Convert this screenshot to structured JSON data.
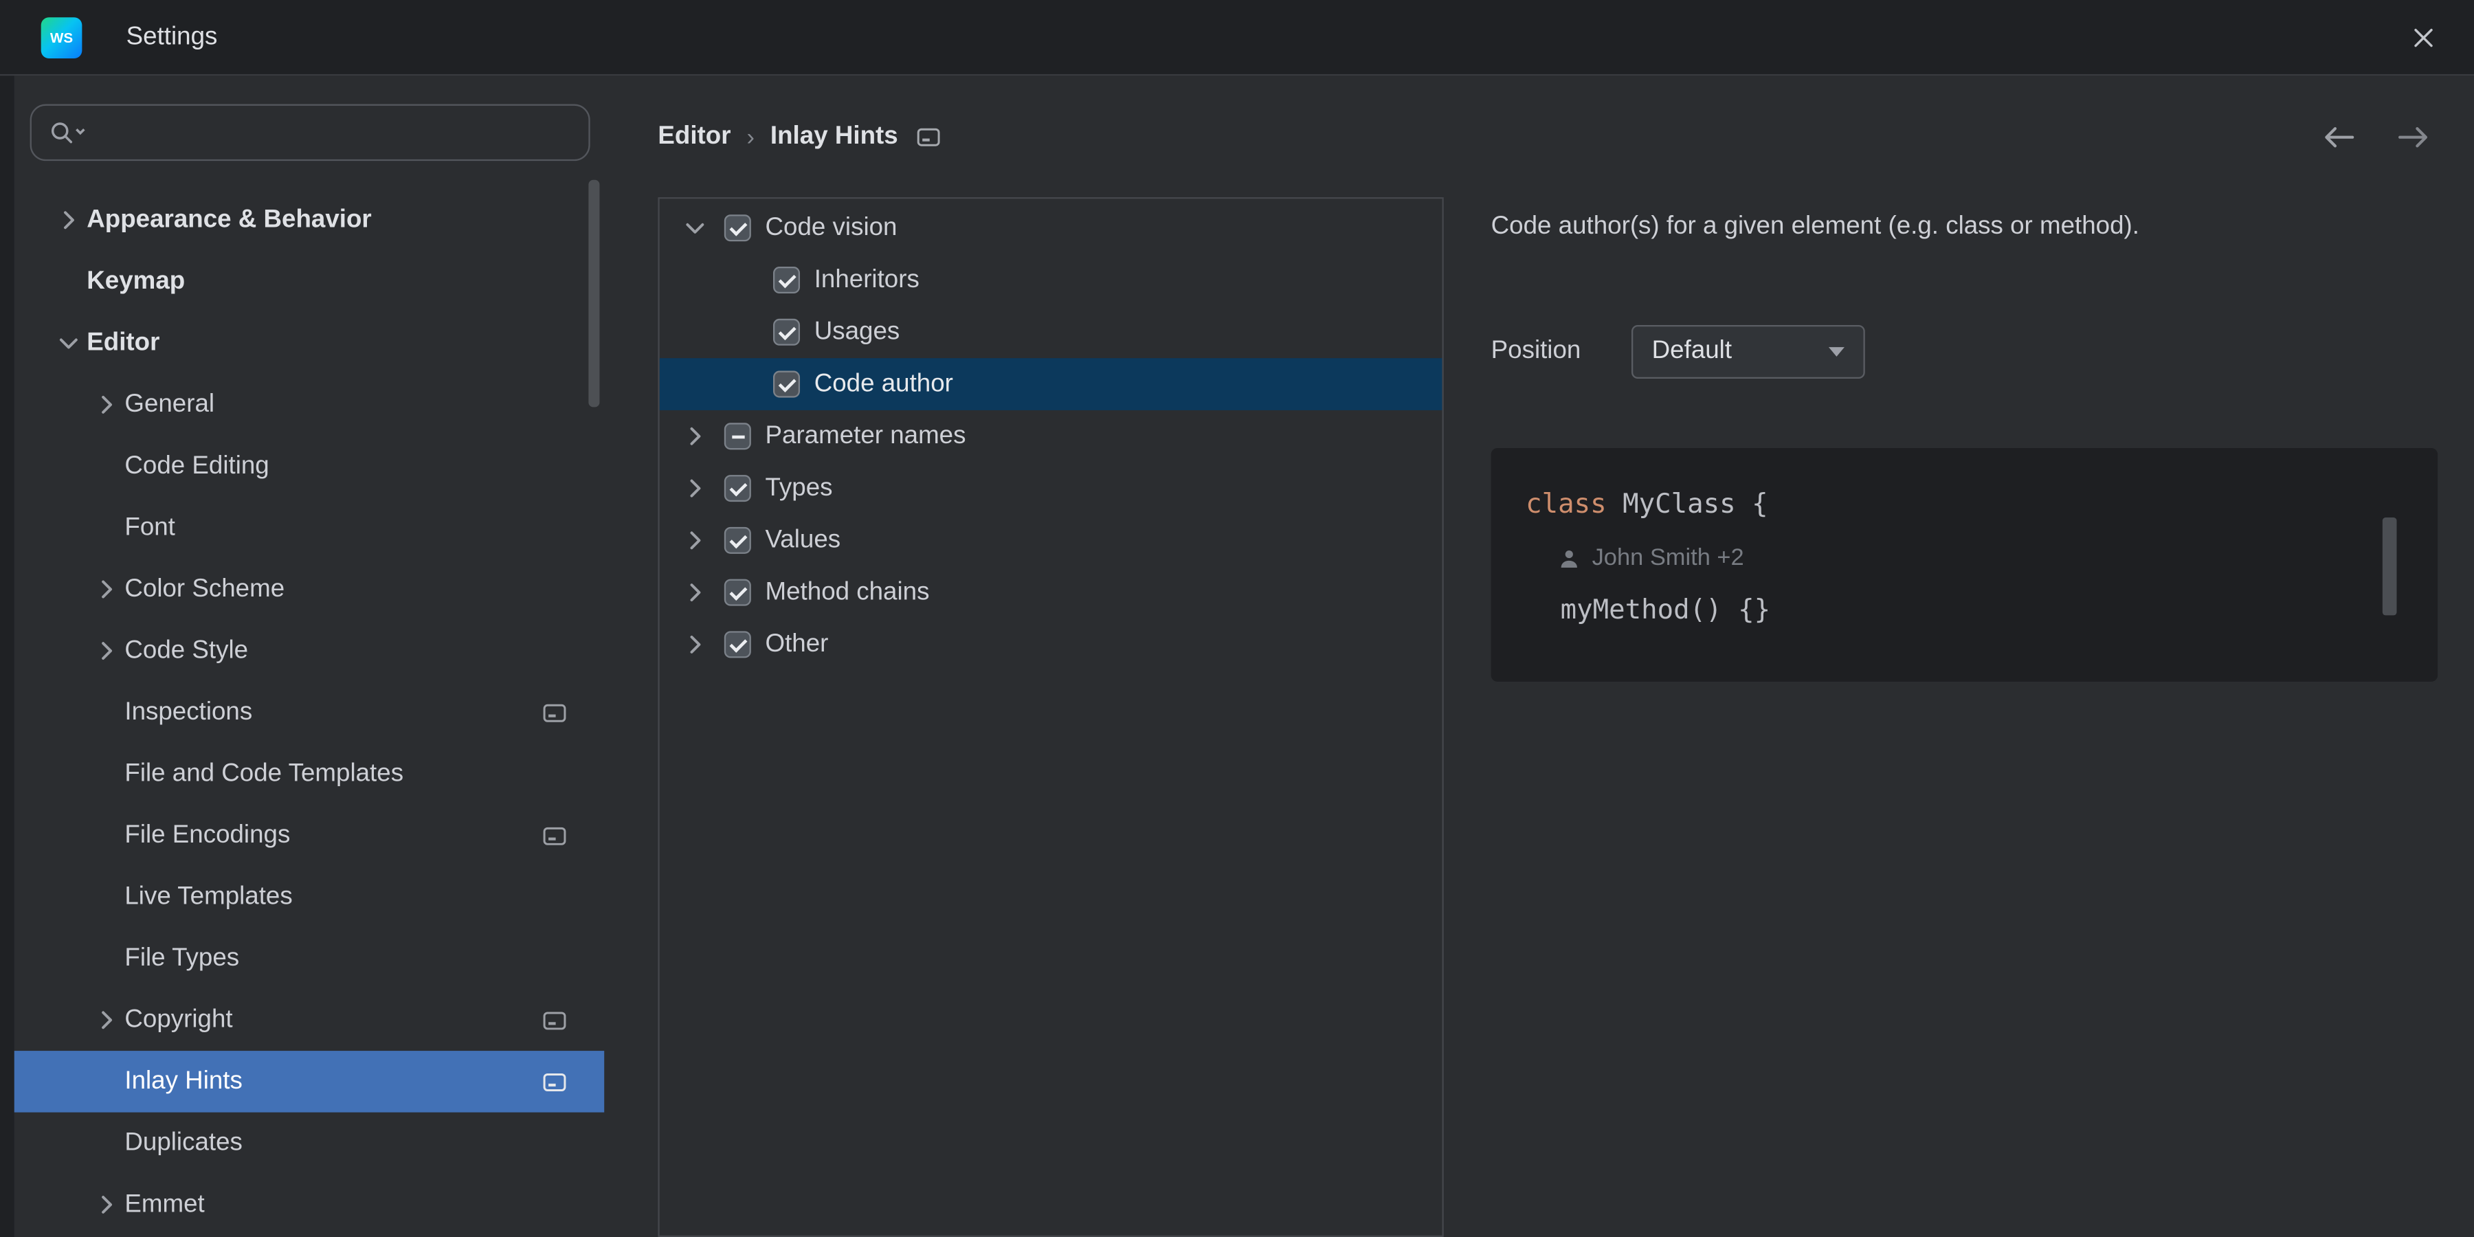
{
  "window": {
    "title": "Settings",
    "logo_text": "WS"
  },
  "sidebar": {
    "search_placeholder": "",
    "items": [
      {
        "label": "Appearance & Behavior",
        "indent": 0,
        "bold": true,
        "chevron": "right"
      },
      {
        "label": "Keymap",
        "indent": 0,
        "bold": true
      },
      {
        "label": "Editor",
        "indent": 0,
        "bold": true,
        "chevron": "down"
      },
      {
        "label": "General",
        "indent": 1,
        "chevron": "right"
      },
      {
        "label": "Code Editing",
        "indent": 1
      },
      {
        "label": "Font",
        "indent": 1
      },
      {
        "label": "Color Scheme",
        "indent": 1,
        "chevron": "right"
      },
      {
        "label": "Code Style",
        "indent": 1,
        "chevron": "right"
      },
      {
        "label": "Inspections",
        "indent": 1,
        "trailing_icon": true
      },
      {
        "label": "File and Code Templates",
        "indent": 1
      },
      {
        "label": "File Encodings",
        "indent": 1,
        "trailing_icon": true
      },
      {
        "label": "Live Templates",
        "indent": 1
      },
      {
        "label": "File Types",
        "indent": 1
      },
      {
        "label": "Copyright",
        "indent": 1,
        "chevron": "right",
        "trailing_icon": true
      },
      {
        "label": "Inlay Hints",
        "indent": 1,
        "trailing_icon": true,
        "selected": true
      },
      {
        "label": "Duplicates",
        "indent": 1
      },
      {
        "label": "Emmet",
        "indent": 1,
        "chevron": "right"
      }
    ]
  },
  "breadcrumb": {
    "parent": "Editor",
    "separator": "›",
    "current": "Inlay Hints"
  },
  "hints_tree": {
    "items": [
      {
        "label": "Code vision",
        "indent": 0,
        "chevron": "down",
        "checkbox": "checked"
      },
      {
        "label": "Inheritors",
        "indent": 1,
        "checkbox": "checked"
      },
      {
        "label": "Usages",
        "indent": 1,
        "checkbox": "checked"
      },
      {
        "label": "Code author",
        "indent": 1,
        "checkbox": "checked",
        "selected": true
      },
      {
        "label": "Parameter names",
        "indent": 0,
        "chevron": "right",
        "checkbox": "indeterminate"
      },
      {
        "label": "Types",
        "indent": 0,
        "chevron": "right",
        "checkbox": "checked"
      },
      {
        "label": "Values",
        "indent": 0,
        "chevron": "right",
        "checkbox": "checked"
      },
      {
        "label": "Method chains",
        "indent": 0,
        "chevron": "right",
        "checkbox": "checked"
      },
      {
        "label": "Other",
        "indent": 0,
        "chevron": "right",
        "checkbox": "checked"
      }
    ]
  },
  "details": {
    "description": "Code author(s) for a given element (e.g. class or method).",
    "position_label": "Position",
    "position_value": "Default",
    "preview": {
      "line1_keyword": "class",
      "line1_rest": " MyClass {",
      "inlay_hint": "John Smith +2",
      "line3": "myMethod() {}"
    }
  },
  "colors": {
    "sidebar_selection": "#4271b6",
    "tree_selection": "#0c395c",
    "keyword_orange": "#cf8e6d",
    "code_text": "#bcbec4",
    "inlay_text": "#787c83",
    "titlebar_bg": "#1f2124",
    "panel_bg": "#2b2d30",
    "preview_bg": "#1e1f22"
  }
}
